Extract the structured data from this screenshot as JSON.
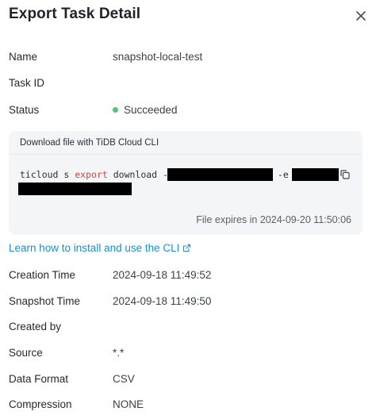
{
  "header": {
    "title": "Export Task Detail",
    "close_icon": "close-icon"
  },
  "details_top": [
    {
      "label": "Name",
      "value": "snapshot-local-test"
    },
    {
      "label": "Task ID",
      "value": ""
    },
    {
      "label": "Status",
      "value": "Succeeded"
    }
  ],
  "status_color": "#52c47a",
  "cli": {
    "heading": "Download file with TiDB Cloud CLI",
    "cmd_prefix": "ticloud s ",
    "cmd_keyword": "export",
    "cmd_rest": " download -c ",
    "cmd_flag_e": "-e",
    "copy_icon": "copy-icon",
    "expiry": "File expires in 2024-09-20 11:50:06"
  },
  "link": {
    "text": "Learn how to install and use the CLI",
    "icon": "external-link-icon"
  },
  "details_bottom": [
    {
      "label": "Creation Time",
      "value": "2024-09-18 11:49:52"
    },
    {
      "label": "Snapshot Time",
      "value": "2024-09-18 11:49:50"
    },
    {
      "label": "Created by",
      "value": ""
    },
    {
      "label": "Source",
      "value": "*.*"
    },
    {
      "label": "Data Format",
      "value": "CSV"
    },
    {
      "label": "Compression",
      "value": "NONE"
    }
  ],
  "colors": {
    "accent_link": "#1a8fc9",
    "command_keyword": "#d0473d",
    "cli_box_bg": "#f4f5f6"
  }
}
